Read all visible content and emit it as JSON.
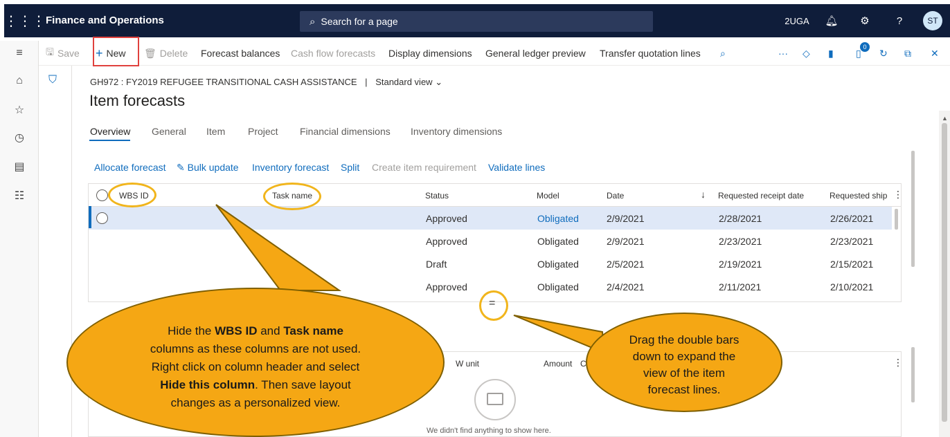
{
  "topbar": {
    "app_title": "Finance and Operations",
    "search_placeholder": "Search for a page",
    "company": "2UGA",
    "avatar": "ST",
    "bg_color": "#0f1d3a"
  },
  "actions": {
    "save": "Save",
    "new": "New",
    "delete": "Delete",
    "forecast_balances": "Forecast balances",
    "cash_flow_forecasts": "Cash flow forecasts",
    "display_dimensions": "Display dimensions",
    "gl_preview": "General ledger preview",
    "transfer_quotation_lines": "Transfer quotation lines",
    "notification_count": "0"
  },
  "breadcrumb": {
    "record": "GH972 : FY2019 REFUGEE TRANSITIONAL CASH ASSISTANCE",
    "separator": "|",
    "view": "Standard view"
  },
  "page_title": "Item forecasts",
  "tabs": [
    "Overview",
    "General",
    "Item",
    "Project",
    "Financial dimensions",
    "Inventory dimensions"
  ],
  "grid_actions": {
    "allocate_forecast": "Allocate forecast",
    "bulk_update": "Bulk update",
    "inventory_forecast": "Inventory forecast",
    "split": "Split",
    "create_item_requirement": "Create item requirement",
    "validate_lines": "Validate lines"
  },
  "grid": {
    "columns": [
      "WBS ID",
      "Task name",
      "Status",
      "Model",
      "Date",
      "Requested receipt date",
      "Requested ship"
    ],
    "sort_indicator": "↓",
    "rows": [
      {
        "status": "Approved",
        "model": "Obligated",
        "date": "2/9/2021",
        "receipt": "2/28/2021",
        "ship": "2/26/2021"
      },
      {
        "status": "Approved",
        "model": "Obligated",
        "date": "2/9/2021",
        "receipt": "2/23/2021",
        "ship": "2/23/2021"
      },
      {
        "status": "Draft",
        "model": "Obligated",
        "date": "2/5/2021",
        "receipt": "2/19/2021",
        "ship": "2/15/2021"
      },
      {
        "status": "Approved",
        "model": "Obligated",
        "date": "2/4/2021",
        "receipt": "2/11/2021",
        "ship": "2/10/2021"
      }
    ]
  },
  "splitter_glyph": "=",
  "lower_grid": {
    "col_unit": "W unit",
    "col_amount": "Amount",
    "col_amount_tail": "C",
    "empty_message": "We didn't find anything to show here."
  },
  "callouts": {
    "left": {
      "line1_pre": "Hide the ",
      "wbs": "WBS ID",
      "and": " and ",
      "task": "Task name",
      "line2": "columns as these columns are not used.",
      "line3": "Right click on column header and select",
      "hide": "Hide this column",
      "line4_post": ". Then save layout",
      "line5": "changes as a personalized view."
    },
    "right": {
      "l1": "Drag the double bars",
      "l2": "down to expand the",
      "l3": "view of the item",
      "l4": "forecast lines."
    },
    "fill_color": "#f5a714"
  }
}
